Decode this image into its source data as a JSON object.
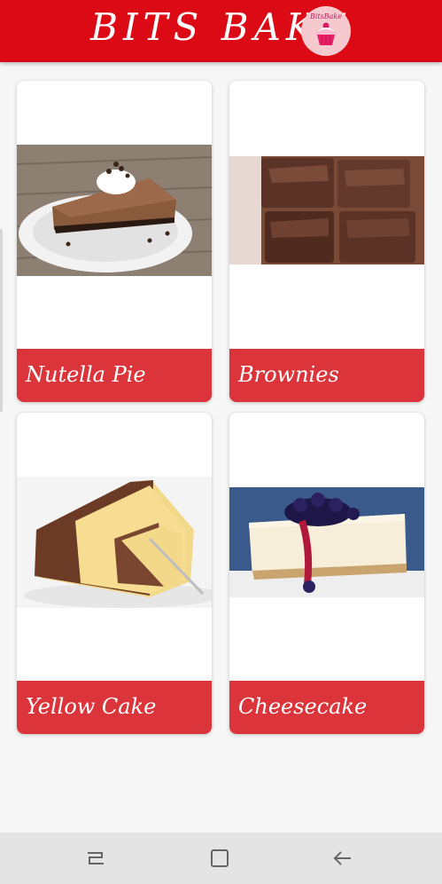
{
  "app": {
    "title": "BITS BAKE",
    "logo_text": "BitsBake"
  },
  "cakes": [
    {
      "name": "Nutella Pie",
      "image": "chocolate-pie-slice"
    },
    {
      "name": "Brownies",
      "image": "brownies-tray"
    },
    {
      "name": "Yellow Cake",
      "image": "yellow-cake-slice"
    },
    {
      "name": "Cheesecake",
      "image": "blueberry-cheesecake-slice"
    }
  ],
  "navbar": {
    "icons": [
      "recent-apps-icon",
      "home-icon",
      "back-icon"
    ]
  },
  "colors": {
    "appbar": "#dc0a14",
    "caption": "#dc343b",
    "background": "#f6f6f6",
    "navbar": "#e4e4e4"
  }
}
